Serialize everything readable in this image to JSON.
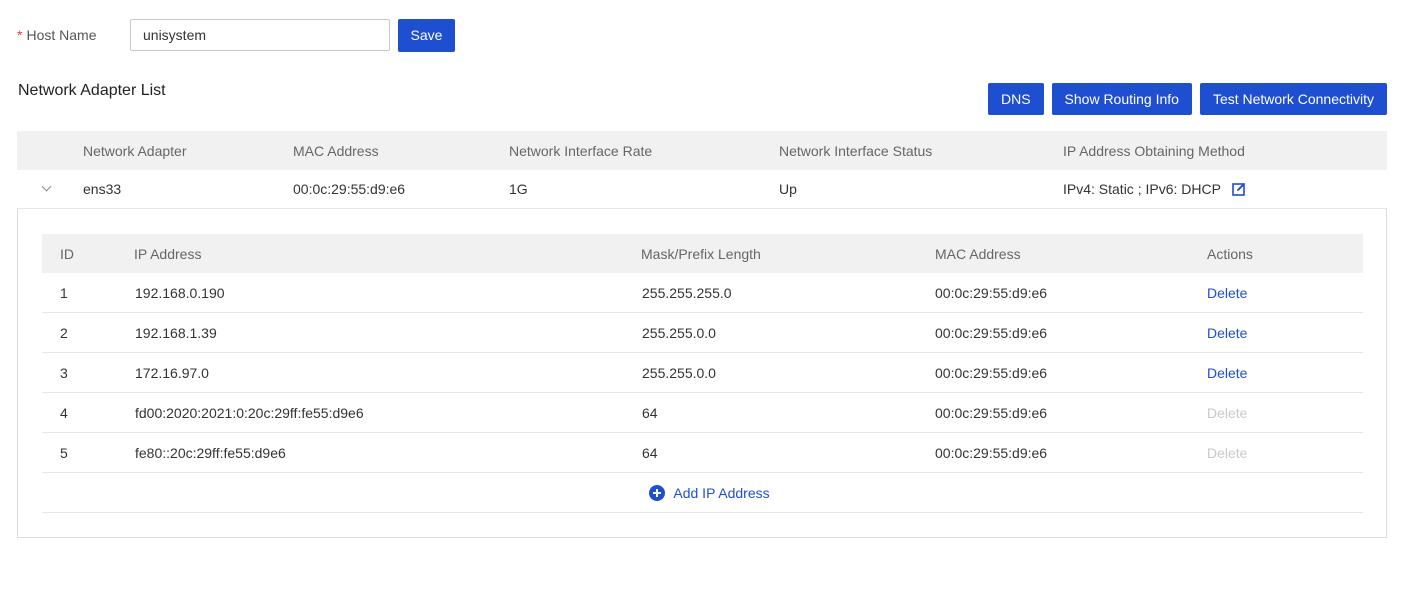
{
  "host": {
    "required_mark": "*",
    "label": "Host Name",
    "value": "unisystem",
    "save_label": "Save"
  },
  "adapter_section": {
    "title": "Network Adapter List",
    "buttons": {
      "dns": "DNS",
      "routing": "Show Routing Info",
      "connectivity": "Test Network Connectivity"
    },
    "columns": {
      "adapter": "Network Adapter",
      "mac": "MAC Address",
      "rate": "Network Interface Rate",
      "status": "Network Interface Status",
      "method": "IP Address Obtaining Method"
    },
    "adapters": [
      {
        "name": "ens33",
        "mac": "00:0c:29:55:d9:e6",
        "rate": "1G",
        "status": "Up",
        "method": "IPv4: Static ; IPv6: DHCP",
        "expanded": true
      }
    ]
  },
  "ip_table": {
    "columns": {
      "id": "ID",
      "ip": "IP Address",
      "mask": "Mask/Prefix Length",
      "mac": "MAC Address",
      "actions": "Actions"
    },
    "rows": [
      {
        "id": "1",
        "ip": "192.168.0.190",
        "mask": "255.255.255.0",
        "mac": "00:0c:29:55:d9:e6",
        "action": "Delete",
        "enabled": true
      },
      {
        "id": "2",
        "ip": "192.168.1.39",
        "mask": "255.255.0.0",
        "mac": "00:0c:29:55:d9:e6",
        "action": "Delete",
        "enabled": true
      },
      {
        "id": "3",
        "ip": "172.16.97.0",
        "mask": "255.255.0.0",
        "mac": "00:0c:29:55:d9:e6",
        "action": "Delete",
        "enabled": true
      },
      {
        "id": "4",
        "ip": "fd00:2020:2021:0:20c:29ff:fe55:d9e6",
        "mask": "64",
        "mac": "00:0c:29:55:d9:e6",
        "action": "Delete",
        "enabled": false
      },
      {
        "id": "5",
        "ip": "fe80::20c:29ff:fe55:d9e6",
        "mask": "64",
        "mac": "00:0c:29:55:d9:e6",
        "action": "Delete",
        "enabled": false
      }
    ],
    "add_label": "Add IP Address"
  },
  "icons": {
    "expand": "chevron-down-icon",
    "edit": "edit-icon",
    "add": "plus-circle-icon"
  },
  "colors": {
    "primary": "#1f4fd1",
    "required": "#e23c3c",
    "disabled_link": "#c8c8c8",
    "header_bg": "#f1f1f1"
  }
}
